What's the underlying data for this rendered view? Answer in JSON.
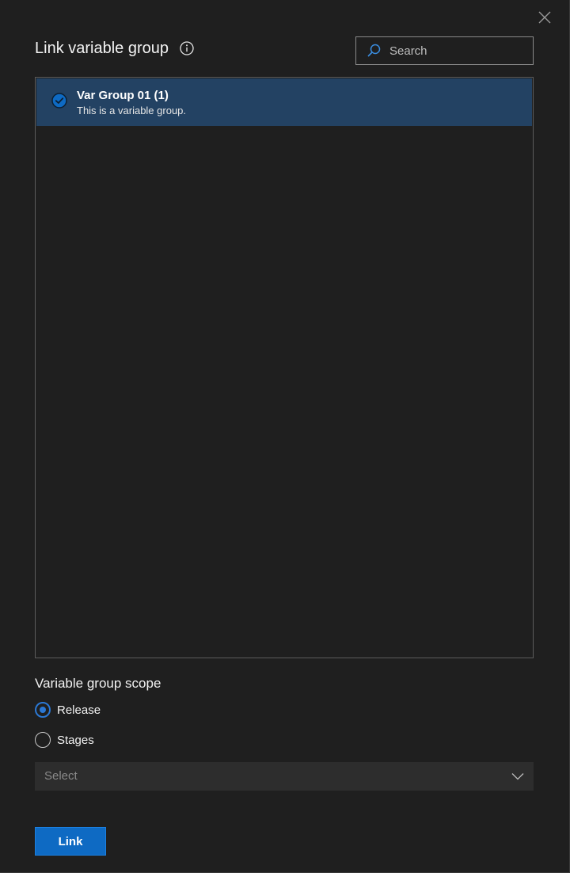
{
  "dialog": {
    "title": "Link variable group",
    "close_icon": "close-icon",
    "info_icon": "info-icon"
  },
  "search": {
    "placeholder": "Search",
    "value": "",
    "icon": "search-icon"
  },
  "variable_groups": [
    {
      "name": "Var Group 01 (1)",
      "description": "This is a variable group.",
      "selected": true
    }
  ],
  "scope": {
    "label": "Variable group scope",
    "options": [
      {
        "label": "Release",
        "checked": true
      },
      {
        "label": "Stages",
        "checked": false
      }
    ],
    "select": {
      "placeholder": "Select",
      "icon": "chevron-down-icon"
    }
  },
  "actions": {
    "link_label": "Link"
  },
  "colors": {
    "background": "#1f1f1f",
    "selected_row": "#234263",
    "accent": "#0e6ac3",
    "radio_accent": "#2b78d4"
  }
}
